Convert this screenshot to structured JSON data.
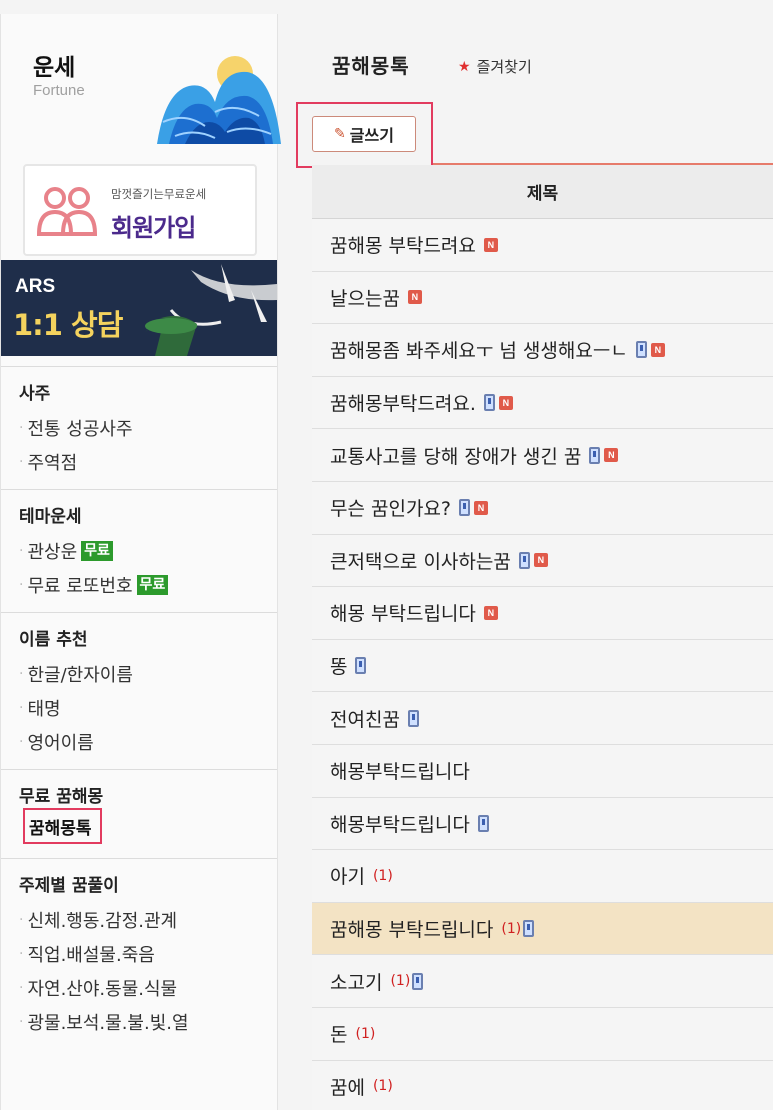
{
  "sidebar": {
    "brand_title": "운세",
    "brand_sub": "Fortune",
    "signup_small": "맘껏즐기는무료운세",
    "signup_big": "회원가입",
    "ars_title": "ARS",
    "ars_sub": "1:1 상담",
    "sections": [
      {
        "head": "사주",
        "items": [
          {
            "label": "전통 성공사주"
          },
          {
            "label": "주역점"
          }
        ]
      },
      {
        "head": "테마운세",
        "items": [
          {
            "label": "관상운",
            "badge": "무료"
          },
          {
            "label": "무료 로또번호",
            "badge": "무료"
          }
        ]
      },
      {
        "head": "이름 추천",
        "items": [
          {
            "label": "한글/한자이름"
          },
          {
            "label": "태명"
          },
          {
            "label": "영어이름"
          }
        ]
      },
      {
        "head": "무료 꿈해몽",
        "items": [
          {
            "label": "꿈해몽톡",
            "active": true
          }
        ]
      },
      {
        "head": "주제별 꿈풀이",
        "items": [
          {
            "label": "신체.행동.감정.관계"
          },
          {
            "label": "직업.배설물.죽음"
          },
          {
            "label": "자연.산야.동물.식물"
          },
          {
            "label": "광물.보석.물.불.빛.열"
          }
        ]
      }
    ]
  },
  "main": {
    "title": "꿈해몽톡",
    "favorite_label": "즐겨찾기",
    "write_label": "글쓰기",
    "column_title": "제목",
    "rows": [
      {
        "title": "꿈해몽 부탁드려요",
        "mobile": false,
        "new": true
      },
      {
        "title": "날으는꿈",
        "mobile": false,
        "new": true
      },
      {
        "title": "꿈해몽좀 봐주세요ㅜ 넘 생생해요ㅡㄴ",
        "mobile": true,
        "new": true
      },
      {
        "title": "꿈해몽부탁드려요.",
        "mobile": true,
        "new": true
      },
      {
        "title": "교통사고를 당해 장애가 생긴 꿈",
        "mobile": true,
        "new": true
      },
      {
        "title": "무슨 꿈인가요?",
        "mobile": true,
        "new": true
      },
      {
        "title": "큰저택으로 이사하는꿈",
        "mobile": true,
        "new": true
      },
      {
        "title": "해몽 부탁드립니다",
        "mobile": false,
        "new": true
      },
      {
        "title": "똥",
        "mobile": true,
        "new": false
      },
      {
        "title": "전여친꿈",
        "mobile": true,
        "new": false
      },
      {
        "title": "해몽부탁드립니다",
        "mobile": false,
        "new": false
      },
      {
        "title": "해몽부탁드립니다",
        "mobile": true,
        "new": false
      },
      {
        "title": "아기",
        "count": "(1)",
        "mobile": false,
        "new": false
      },
      {
        "title": "꿈해몽 부탁드립니다",
        "count": "(1)",
        "mobile": true,
        "new": false,
        "highlight": true
      },
      {
        "title": "소고기",
        "count": "(1)",
        "mobile": true,
        "new": false
      },
      {
        "title": "돈",
        "count": "(1)",
        "mobile": false,
        "new": false
      },
      {
        "title": "꿈에",
        "count": "(1)",
        "mobile": false,
        "new": false
      }
    ],
    "new_badge_text": "N"
  }
}
